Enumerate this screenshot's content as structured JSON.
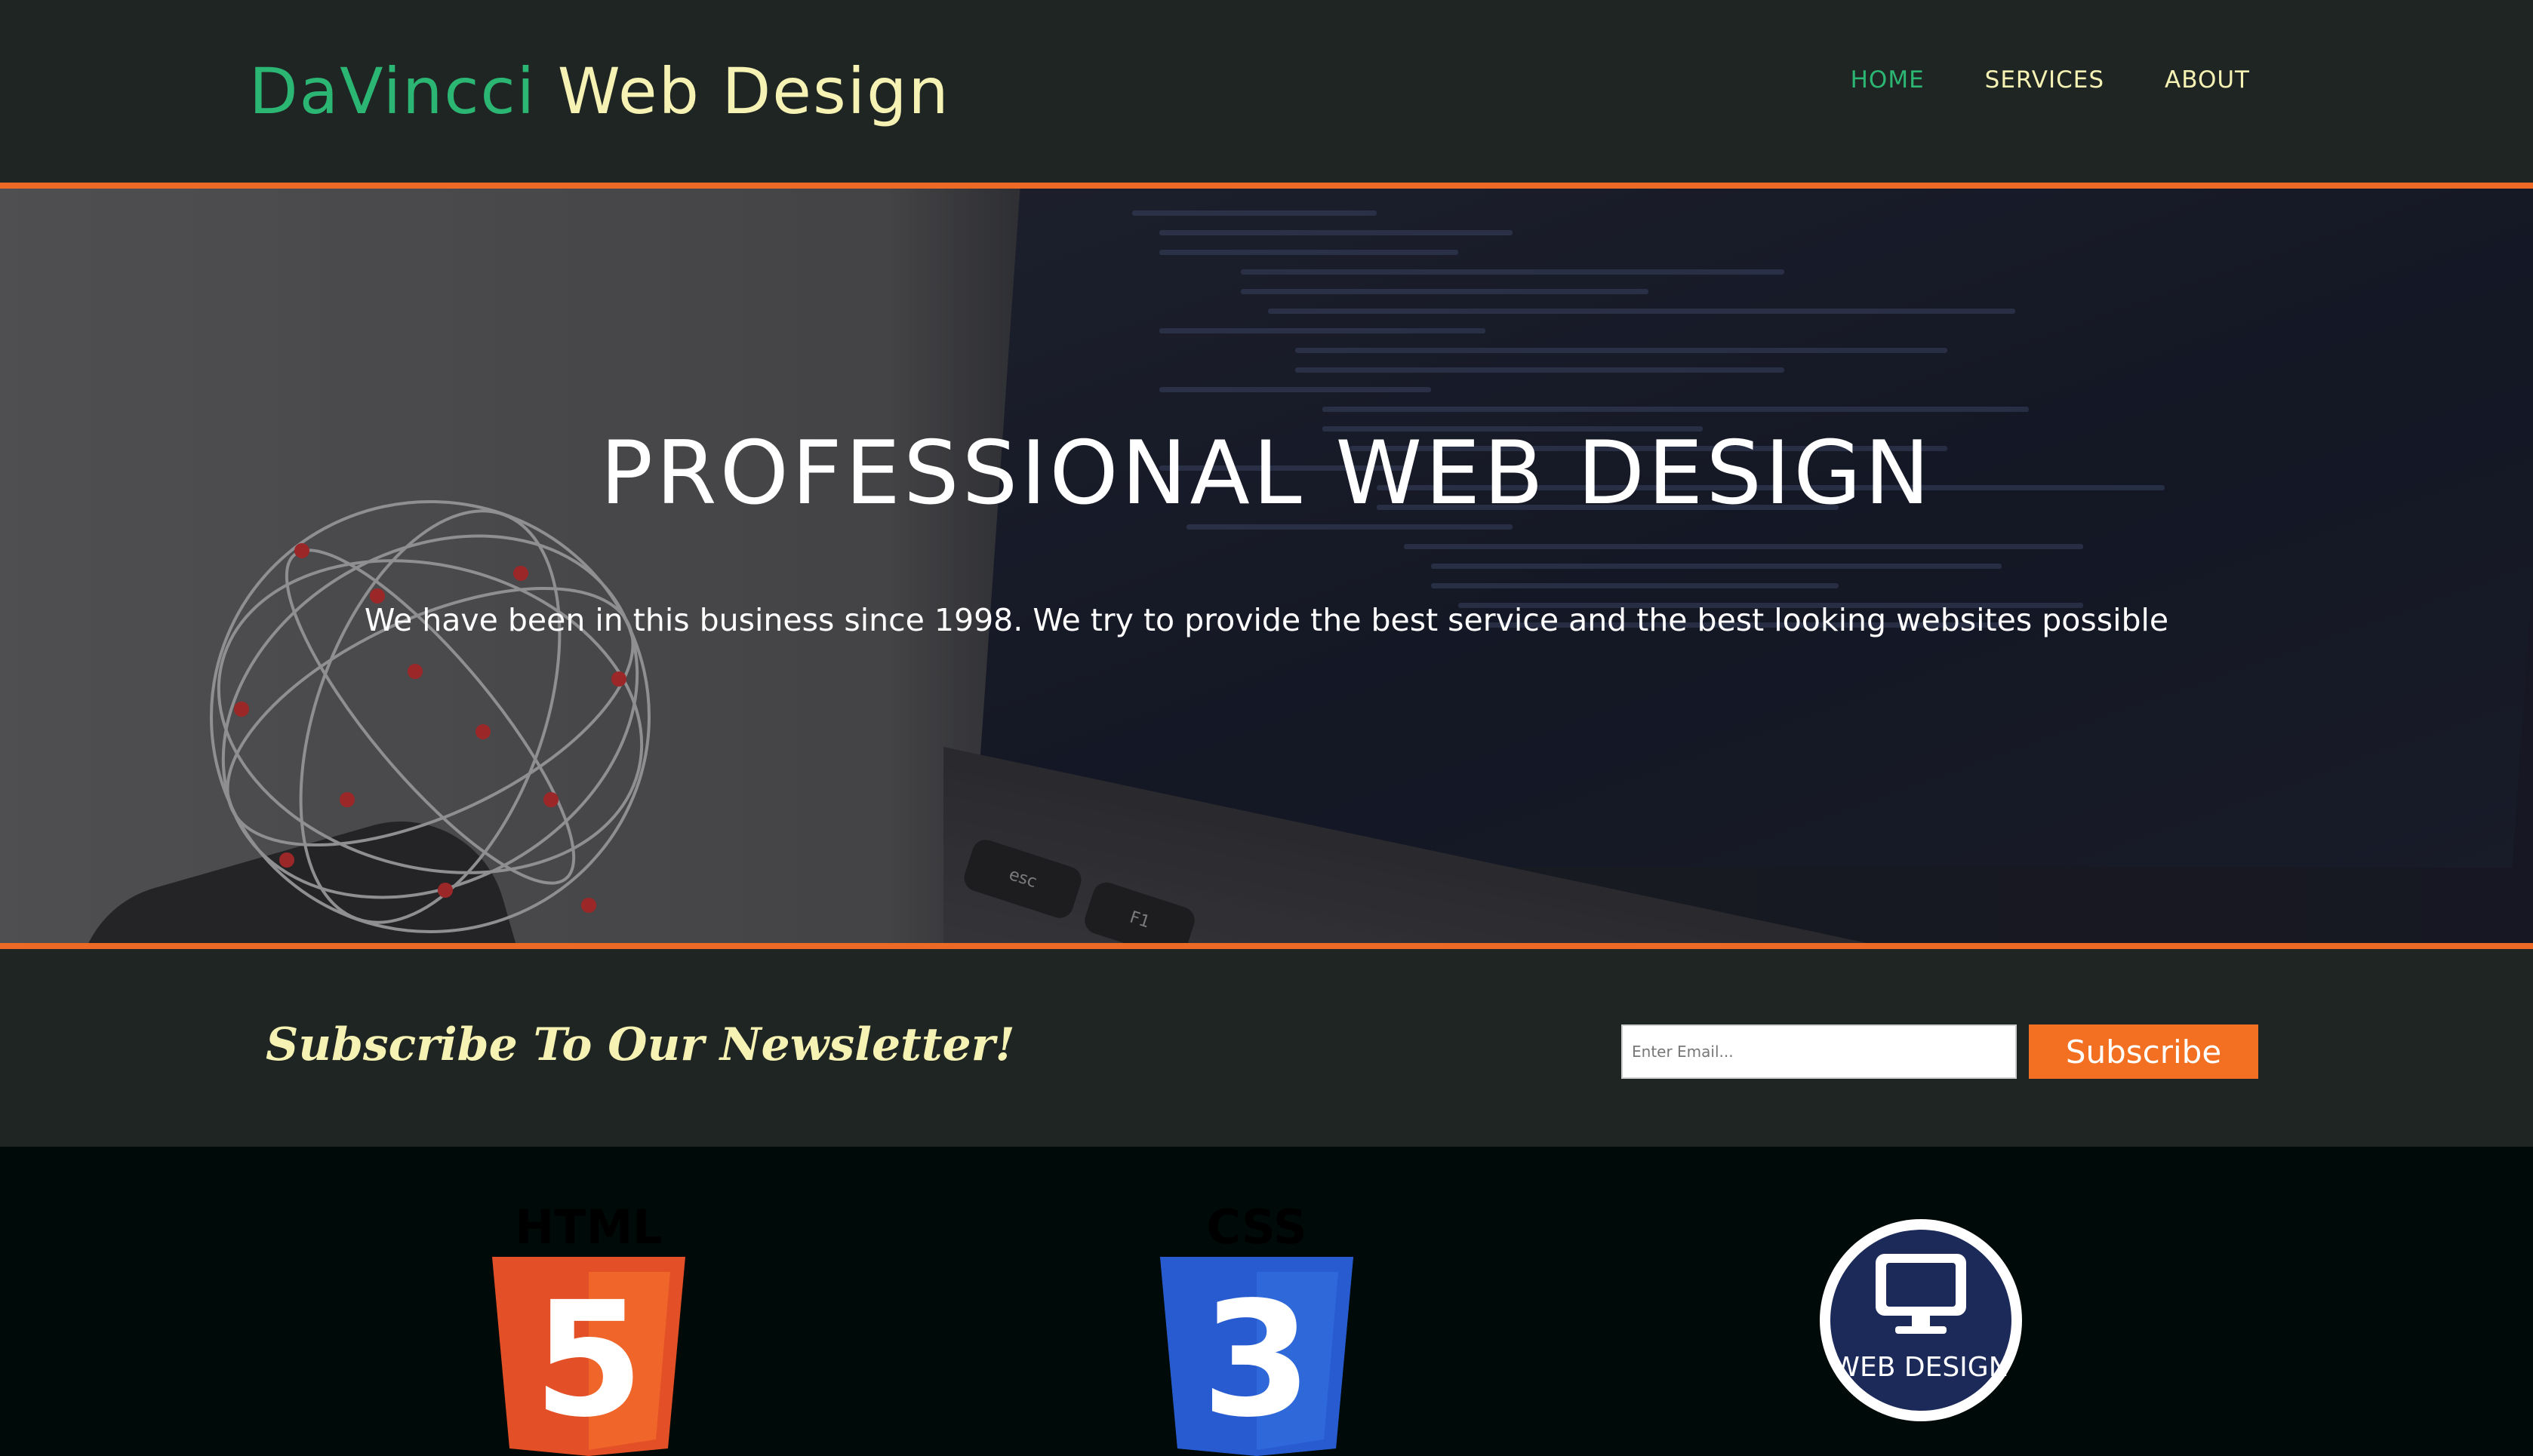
{
  "header": {
    "brand_part1": "DaVincci",
    "brand_part2": "Web Design",
    "nav": [
      {
        "label": "HOME",
        "active": true
      },
      {
        "label": "SERVICES",
        "active": false
      },
      {
        "label": "ABOUT",
        "active": false
      }
    ]
  },
  "hero": {
    "title": "PROFESSIONAL WEB DESIGN",
    "subtitle": "We have been in this business since 1998. We try to provide the best service and the best looking websites possible",
    "keys": [
      "esc",
      "F1"
    ]
  },
  "newsletter": {
    "title": "Subscribe To Our Newsletter!",
    "placeholder": "Enter Email...",
    "button": "Subscribe"
  },
  "logos": {
    "html_label": "HTML",
    "css_label": "CSS",
    "webdesign_label": "WEB DESIGN",
    "html_digit": "5",
    "css_digit": "3"
  },
  "colors": {
    "accent_orange": "#ec6a26",
    "brand_green": "#2bb673",
    "cream": "#f6f2b4",
    "header_bg": "#1f2523"
  }
}
